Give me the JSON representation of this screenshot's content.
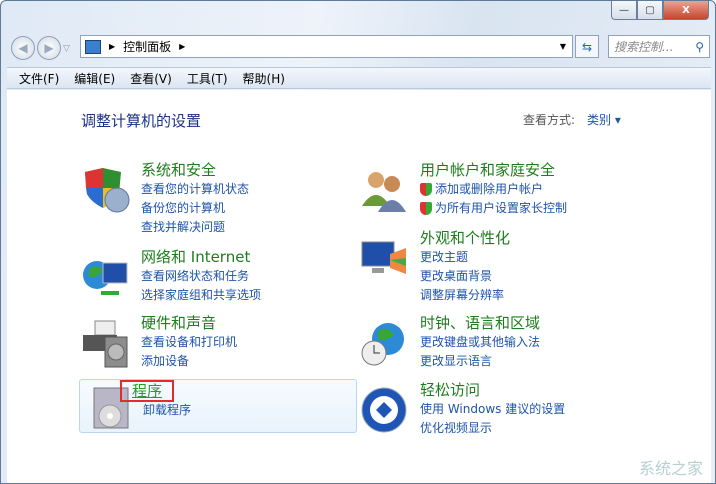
{
  "window": {
    "controls": {
      "minimize": "—",
      "maximize": "▢",
      "close": "X"
    }
  },
  "address": {
    "path": "控制面板",
    "search_placeholder": "搜索控制..."
  },
  "menu": [
    "文件(F)",
    "编辑(E)",
    "查看(V)",
    "工具(T)",
    "帮助(H)"
  ],
  "main": {
    "title": "调整计算机的设置",
    "view_label": "查看方式:",
    "view_value": "类别"
  },
  "categories": [
    {
      "title": "系统和安全",
      "links": [
        "查看您的计算机状态",
        "备份您的计算机",
        "查找并解决问题"
      ]
    },
    {
      "title": "网络和 Internet",
      "links": [
        "查看网络状态和任务",
        "选择家庭组和共享选项"
      ]
    },
    {
      "title": "硬件和声音",
      "links": [
        "查看设备和打印机",
        "添加设备"
      ]
    },
    {
      "title": "程序",
      "links": [
        "卸载程序"
      ]
    },
    {
      "title": "用户帐户和家庭安全",
      "links": [
        "添加或删除用户帐户",
        "为所有用户设置家长控制"
      ]
    },
    {
      "title": "外观和个性化",
      "links": [
        "更改主题",
        "更改桌面背景",
        "调整屏幕分辨率"
      ]
    },
    {
      "title": "时钟、语言和区域",
      "links": [
        "更改键盘或其他输入法",
        "更改显示语言"
      ]
    },
    {
      "title": "轻松访问",
      "links": [
        "使用 Windows 建议的设置",
        "优化视频显示"
      ]
    }
  ],
  "watermark": "系统之家"
}
